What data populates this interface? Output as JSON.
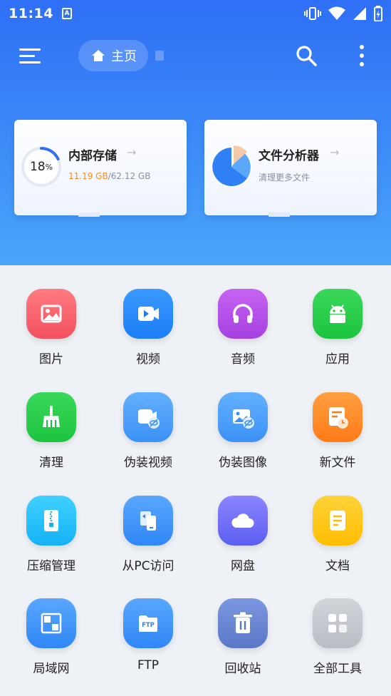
{
  "status": {
    "time": "11:14",
    "notif_letter": "A"
  },
  "toolbar": {
    "home_label": "主页"
  },
  "cards": {
    "storage": {
      "title": "内部存储",
      "percent": "18",
      "percent_sign": "%",
      "used": "11.19 GB",
      "separator": "/",
      "total": "62.12 GB",
      "usage_fraction": 0.18
    },
    "analyzer": {
      "title": "文件分析器",
      "subtitle": "清理更多文件"
    },
    "arrow": "→"
  },
  "tools": [
    {
      "label": "图片",
      "icon": "image-icon",
      "color": "#f2505f",
      "color2": "#ff7c80"
    },
    {
      "label": "视频",
      "icon": "video-icon",
      "color": "#1b7cf5",
      "color2": "#3a9bff"
    },
    {
      "label": "音频",
      "icon": "headphones-icon",
      "color": "#a640e0",
      "color2": "#c763f2"
    },
    {
      "label": "应用",
      "icon": "android-icon",
      "color": "#1cc43d",
      "color2": "#3ad85a"
    },
    {
      "label": "清理",
      "icon": "broom-icon",
      "color": "#1cc43d",
      "color2": "#3ad85a"
    },
    {
      "label": "伪装视频",
      "icon": "hidden-video-icon",
      "color": "#3b91f5",
      "color2": "#63b0ff"
    },
    {
      "label": "伪装图像",
      "icon": "hidden-image-icon",
      "color": "#3b91f5",
      "color2": "#63b0ff"
    },
    {
      "label": "新文件",
      "icon": "new-file-icon",
      "color": "#ff7b17",
      "color2": "#ffa040"
    },
    {
      "label": "压缩管理",
      "icon": "zip-icon",
      "color": "#15b2f5",
      "color2": "#3fd0ff"
    },
    {
      "label": "从PC访问",
      "icon": "pc-transfer-icon",
      "color": "#2f86f5",
      "color2": "#5aa8ff"
    },
    {
      "label": "网盘",
      "icon": "cloud-icon",
      "color": "#5a5ff0",
      "color2": "#8d84ff"
    },
    {
      "label": "文档",
      "icon": "document-icon",
      "color": "#ffbd00",
      "color2": "#ffd23a"
    },
    {
      "label": "局域网",
      "icon": "lan-icon",
      "color": "#2f86f5",
      "color2": "#5aa8ff"
    },
    {
      "label": "FTP",
      "icon": "ftp-icon",
      "color": "#2f86f5",
      "color2": "#5aa8ff",
      "badge": "FTP"
    },
    {
      "label": "回收站",
      "icon": "trash-icon",
      "color": "#5a78c8",
      "color2": "#7c97e0"
    },
    {
      "label": "全部工具",
      "icon": "all-tools-icon",
      "color": "#b9bcc4",
      "color2": "#d2d4da"
    }
  ]
}
